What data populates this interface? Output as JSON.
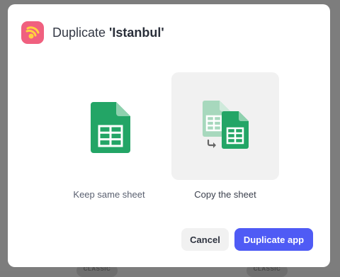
{
  "dialog": {
    "title_prefix": "Duplicate ",
    "title_name": "'Istanbul'",
    "app_icon": "app-logo-icon",
    "accent_color": "#f0607f"
  },
  "options": [
    {
      "label": "Keep same sheet",
      "icon": "spreadsheet-icon",
      "selected": false
    },
    {
      "label": "Copy the sheet",
      "icon": "copy-spreadsheet-icon",
      "selected": true
    }
  ],
  "actions": {
    "cancel_label": "Cancel",
    "primary_label": "Duplicate app",
    "primary_color": "#4f5bf5"
  },
  "background": {
    "badges": [
      "CLASSIC",
      "CLASSIC"
    ]
  }
}
